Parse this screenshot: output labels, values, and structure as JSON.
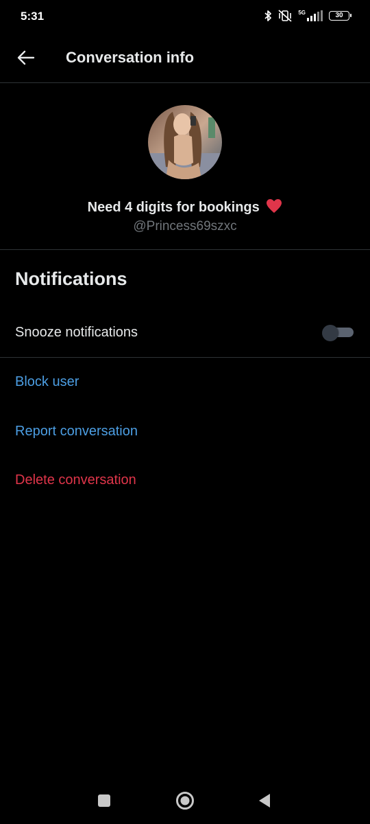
{
  "status_bar": {
    "time": "5:31",
    "network": "5G",
    "battery": "30"
  },
  "header": {
    "title": "Conversation info"
  },
  "profile": {
    "display_name": "Need 4 digits for bookings",
    "handle": "@Princess69szxc"
  },
  "notifications": {
    "heading": "Notifications",
    "snooze_label": "Snooze notifications",
    "snooze_enabled": false
  },
  "actions": {
    "block_label": "Block user",
    "report_label": "Report conversation",
    "delete_label": "Delete conversation"
  },
  "colors": {
    "background": "#000000",
    "link_blue": "#4c9ee3",
    "danger_red": "#e0354a",
    "secondary_text": "#71767b",
    "divider": "#2f3336"
  },
  "icons": {
    "back": "arrow-left-icon",
    "heart": "red-heart-icon",
    "bluetooth": "bluetooth-icon",
    "mute": "vibrate-off-icon",
    "signal": "signal-bars-icon",
    "nav_recent": "square-icon",
    "nav_home": "circle-icon",
    "nav_back": "triangle-icon"
  }
}
